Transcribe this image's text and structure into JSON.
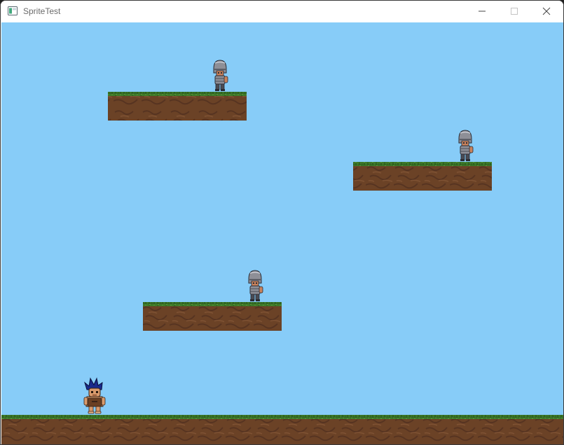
{
  "window": {
    "title": "SpriteTest",
    "app_icon": "window-app-icon",
    "controls": [
      "minimize-icon",
      "maximize-icon",
      "close-icon"
    ]
  },
  "game": {
    "sky_color": "#87CCF8",
    "grass_color": "#3E7A2A",
    "dirt_color": "#6B4226",
    "player_sprite": "caveman-player",
    "enemy_sprite": "armored-knight",
    "enemy_count": 3,
    "platform_count": 3
  }
}
